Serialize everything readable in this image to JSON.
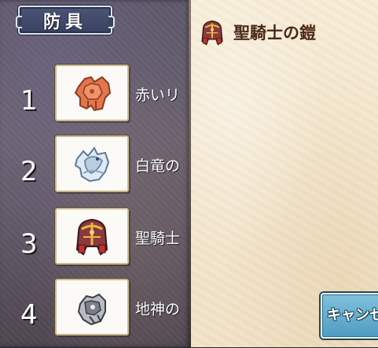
{
  "category_tab": {
    "label": "防具"
  },
  "items": [
    {
      "number": "1",
      "name": "赤いリ",
      "icon": "red-leather-armor-icon"
    },
    {
      "number": "2",
      "name": "白竜の",
      "icon": "white-dragon-armor-icon"
    },
    {
      "number": "3",
      "name": "聖騎士",
      "icon": "holy-knight-armor-icon"
    },
    {
      "number": "4",
      "name": "地神の",
      "icon": "earth-god-armor-icon"
    }
  ],
  "detail": {
    "title": "聖騎士の鎧",
    "icon": "holy-knight-armor-icon"
  },
  "cancel_button": {
    "label": "キャンセル"
  },
  "colors": {
    "parchment": "#f4e7cf",
    "title_text": "#4a2a14",
    "tab_bg": "#3a4262",
    "cancel_button": "#5fa9cc"
  }
}
